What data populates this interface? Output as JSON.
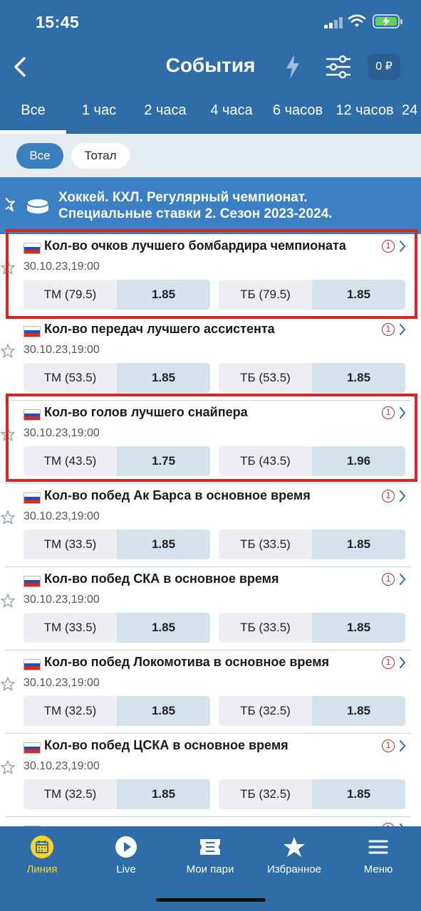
{
  "status_bar": {
    "time": "15:45"
  },
  "header": {
    "title": "События",
    "balance": "0 ₽"
  },
  "time_tabs": [
    {
      "label": "Все",
      "active": true
    },
    {
      "label": "1 час"
    },
    {
      "label": "2 часа"
    },
    {
      "label": "4 часа"
    },
    {
      "label": "6 часов"
    },
    {
      "label": "12 часов"
    },
    {
      "label": "24"
    }
  ],
  "filter_chips": [
    {
      "label": "Все",
      "active": true
    },
    {
      "label": "Тотал"
    }
  ],
  "league": {
    "line1": "Хоккей. КХЛ. Регулярный чемпионат.",
    "line2": "Специальные ставки 2. Сезон 2023-2024."
  },
  "events": [
    {
      "name": "Кол-во очков лучшего бомбардира чемпионата",
      "date": "30.10.23,19:00",
      "under_label": "ТМ (79.5)",
      "under_odds": "1.85",
      "over_label": "ТБ (79.5)",
      "over_odds": "1.85",
      "info": "1"
    },
    {
      "name": "Кол-во передач лучшего ассистента",
      "date": "30.10.23,19:00",
      "under_label": "ТМ (53.5)",
      "under_odds": "1.85",
      "over_label": "ТБ (53.5)",
      "over_odds": "1.85",
      "info": "1"
    },
    {
      "name": "Кол-во голов лучшего снайпера",
      "date": "30.10.23,19:00",
      "under_label": "ТМ (43.5)",
      "under_odds": "1.75",
      "over_label": "ТБ (43.5)",
      "over_odds": "1.96",
      "info": "1"
    },
    {
      "name": "Кол-во побед Ак Барса в основное время",
      "date": "30.10.23,19:00",
      "under_label": "ТМ (33.5)",
      "under_odds": "1.85",
      "over_label": "ТБ (33.5)",
      "over_odds": "1.85",
      "info": "1"
    },
    {
      "name": "Кол-во побед СКА в основное время",
      "date": "30.10.23,19:00",
      "under_label": "ТМ (33.5)",
      "under_odds": "1.85",
      "over_label": "ТБ (33.5)",
      "over_odds": "1.85",
      "info": "1"
    },
    {
      "name": "Кол-во побед Локомотива в основное время",
      "date": "30.10.23,19:00",
      "under_label": "ТМ (32.5)",
      "under_odds": "1.85",
      "over_label": "ТБ (32.5)",
      "over_odds": "1.85",
      "info": "1"
    },
    {
      "name": "Кол-во побед ЦСКА в основное время",
      "date": "30.10.23,19:00",
      "under_label": "ТМ (32.5)",
      "under_odds": "1.85",
      "over_label": "ТБ (32.5)",
      "over_odds": "1.85",
      "info": "1"
    },
    {
      "name": "",
      "date": "",
      "under_label": "",
      "under_odds": "",
      "over_label": "",
      "over_odds": "",
      "info": "1"
    }
  ],
  "bottom_nav": [
    {
      "label": "Линия",
      "icon": "calendar-icon",
      "active": true
    },
    {
      "label": "Live",
      "icon": "play-icon"
    },
    {
      "label": "Мои пари",
      "icon": "ticket-icon"
    },
    {
      "label": "Избранное",
      "icon": "star-icon"
    },
    {
      "label": "Меню",
      "icon": "menu-icon"
    }
  ],
  "colors": {
    "primary": "#2f6da8",
    "league_bar": "#3b7fc4",
    "highlight": "#d8261f",
    "active_nav": "#ffd21f",
    "odds_cell": "#d4e2ec"
  }
}
